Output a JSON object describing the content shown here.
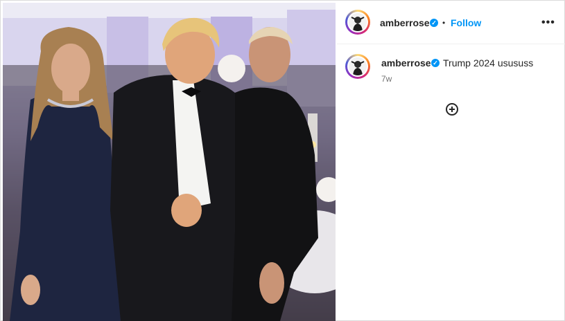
{
  "post": {
    "author": {
      "username": "amberrose",
      "verified_icon": "verified-badge-icon",
      "follow_label": "Follow",
      "separator": "•",
      "more_icon": "more-options-icon",
      "more_label": "•••"
    },
    "caption": {
      "username": "amberrose",
      "text": "Trump 2024 usususs",
      "timestamp": "7w"
    },
    "add_comment_icon": "plus-circle-icon"
  },
  "colors": {
    "link_blue": "#0095f6",
    "text": "#262626",
    "muted": "#737373"
  }
}
